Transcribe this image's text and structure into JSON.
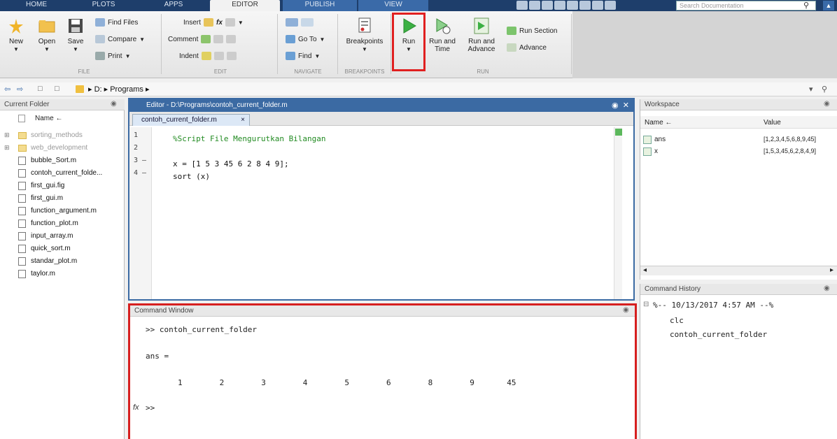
{
  "tabs": [
    {
      "label": "HOME"
    },
    {
      "label": "PLOTS"
    },
    {
      "label": "APPS"
    },
    {
      "label": "EDITOR"
    },
    {
      "label": "PUBLISH"
    },
    {
      "label": "VIEW"
    }
  ],
  "search": {
    "placeholder": "Search Documentation"
  },
  "ribbon": {
    "file": {
      "label": "FILE",
      "new": "New",
      "open": "Open",
      "save": "Save",
      "find_files": "Find Files",
      "compare": "Compare",
      "print": "Print"
    },
    "edit": {
      "label": "EDIT",
      "insert": "Insert",
      "comment": "Comment",
      "indent": "Indent",
      "fx": "fx"
    },
    "navigate": {
      "label": "NAVIGATE",
      "go_to": "Go To",
      "find": "Find"
    },
    "breakpoints": {
      "label": "BREAKPOINTS",
      "breakpoints": "Breakpoints"
    },
    "run": {
      "label": "RUN",
      "run": "Run",
      "run_and_time_1": "Run and",
      "run_and_time_2": "Time",
      "run_and_advance_1": "Run and",
      "run_and_advance_2": "Advance",
      "run_section": "Run Section",
      "advance": "Advance"
    }
  },
  "address": {
    "drive": "D:",
    "folder": "Programs"
  },
  "current_folder": {
    "title": "Current Folder",
    "column": "Name ←",
    "items": [
      {
        "name": "sorting_methods"
      },
      {
        "name": "web_development"
      },
      {
        "name": "bubble_Sort.m"
      },
      {
        "name": "contoh_current_folde..."
      },
      {
        "name": "first_gui.fig"
      },
      {
        "name": "first_gui.m"
      },
      {
        "name": "function_argument.m"
      },
      {
        "name": "function_plot.m"
      },
      {
        "name": "input_array.m"
      },
      {
        "name": "quick_sort.m"
      },
      {
        "name": "standar_plot.m"
      },
      {
        "name": "taylor.m"
      }
    ]
  },
  "editor": {
    "title": "Editor - D:\\Programs\\contoh_current_folder.m",
    "tab": "contoh_current_folder.m",
    "line_numbers": [
      "1",
      "2",
      "3 –",
      "4 –"
    ],
    "lines": [
      "%Script File Mengurutkan Bilangan",
      "",
      "x = [1 5 3 45 6 2 8 4 9];",
      "sort (x)"
    ]
  },
  "command_window": {
    "title": "Command Window",
    "lines": [
      ">> contoh_current_folder",
      "ans =",
      "1        2        3        4        5        6        8        9       45",
      ">>"
    ],
    "fx": "fx"
  },
  "workspace": {
    "title": "Workspace",
    "col_name": "Name ←",
    "col_value": "Value",
    "rows": [
      {
        "name": "ans",
        "value": "[1,2,3,4,5,6,8,9,45]"
      },
      {
        "name": "x",
        "value": "[1,5,3,45,6,2,8,4,9]"
      }
    ]
  },
  "command_history": {
    "title": "Command History",
    "lines": [
      "%-- 10/13/2017 4:57 AM --%",
      "clc",
      "contoh_current_folder"
    ]
  },
  "colors": {
    "accent": "#3b6aa3",
    "highlight": "#d61f1f",
    "comment": "#228b22"
  }
}
